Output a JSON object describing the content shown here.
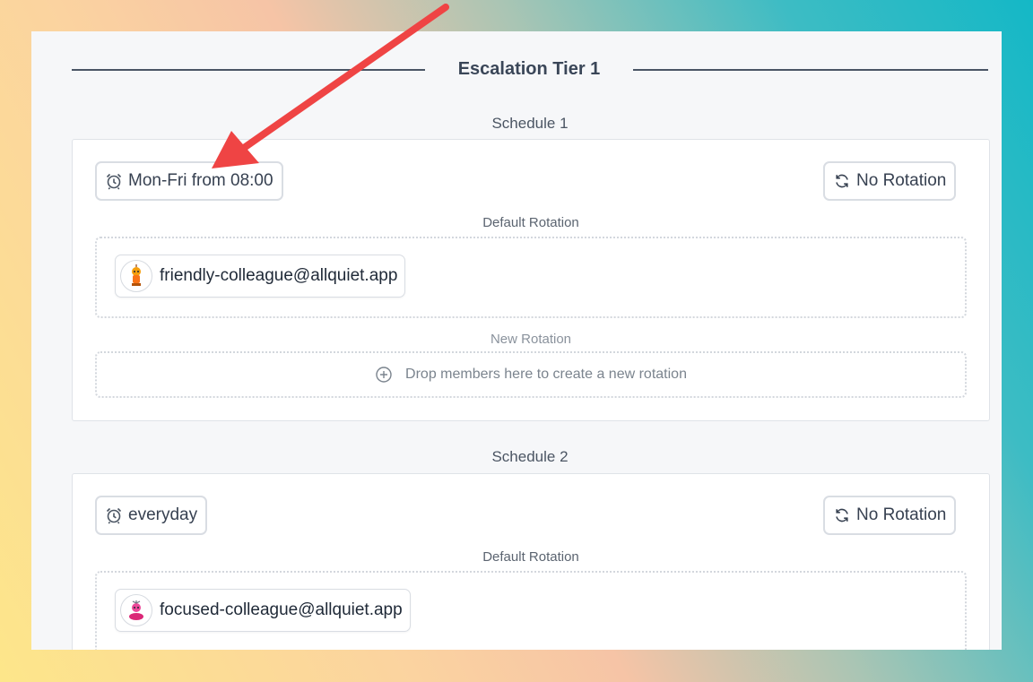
{
  "tier": {
    "title": "Escalation Tier 1"
  },
  "schedules": [
    {
      "title": "Schedule 1",
      "time_label": "Mon-Fri from 08:00",
      "rotation_label": "No Rotation",
      "default_rotation_label": "Default Rotation",
      "members": [
        {
          "email": "friendly-colleague@allquiet.app",
          "avatar": "orange-robot-avatar"
        }
      ],
      "new_rotation_label": "New Rotation",
      "dropzone_hint": "Drop members here to create a new rotation"
    },
    {
      "title": "Schedule 2",
      "time_label": "everyday",
      "rotation_label": "No Rotation",
      "default_rotation_label": "Default Rotation",
      "members": [
        {
          "email": "focused-colleague@allquiet.app",
          "avatar": "pink-robot-avatar"
        }
      ]
    }
  ],
  "annotation": {
    "color": "#ef4444"
  },
  "icons": {
    "time": "alarm-clock-icon",
    "rotation": "rotate-icon",
    "add": "plus-circle-icon"
  }
}
